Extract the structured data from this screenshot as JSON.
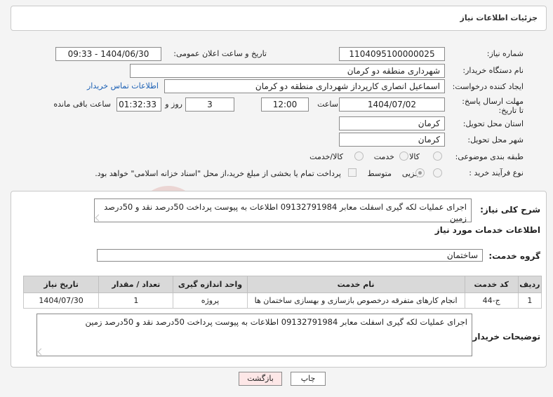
{
  "header": {
    "title": "جزئیات اطلاعات نیاز"
  },
  "fields": {
    "need_number_label": "شماره نیاز:",
    "need_number": "1104095100000025",
    "announce_label": "تاریخ و ساعت اعلان عمومی:",
    "announce_value": "1404/06/30 - 09:33",
    "buyer_org_label": "نام دستگاه خریدار:",
    "buyer_org": "شهرداری منطقه دو کرمان",
    "creator_label": "ایجاد کننده درخواست:",
    "creator": "اسماعیل انصاری کارپرداز شهرداری منطقه دو کرمان",
    "contact_link": "اطلاعات تماس خریدار",
    "deadline_label": "مهلت ارسال پاسخ: تا تاریخ:",
    "deadline_date": "1404/07/02",
    "time_label": "ساعت",
    "deadline_time": "12:00",
    "days_value": "3",
    "days_label": "روز و",
    "remaining_time": "01:32:33",
    "remaining_label": "ساعت باقی مانده",
    "province_label": "استان محل تحویل:",
    "province": "کرمان",
    "city_label": "شهر محل تحویل:",
    "city": "کرمان",
    "category_label": "طبقه بندی موضوعی:",
    "category_options": [
      "کالا",
      "خدمت",
      "کالا/خدمت"
    ],
    "process_label": "نوع فرآیند خرید :",
    "process_options": [
      "جزیی",
      "متوسط"
    ],
    "payment_note": "پرداخت تمام یا بخشی از مبلغ خرید،از محل \"اسناد خزانه اسلامی\" خواهد بود."
  },
  "summary": {
    "label": "شرح کلی نیاز:",
    "text": "اجرای عملیات لکه گیری اسفلت معابر 09132791984 اطلاعات به پیوست پرداخت 50درصد نقد و 50درصد زمین"
  },
  "services": {
    "title": "اطلاعات خدمات مورد نیاز",
    "group_label": "گروه خدمت:",
    "group_value": "ساختمان",
    "columns": [
      "ردیف",
      "کد خدمت",
      "نام خدمت",
      "واحد اندازه گیری",
      "تعداد / مقدار",
      "تاریخ نیاز"
    ],
    "rows": [
      [
        "1",
        "ج-44",
        "انجام کارهای متفرقه درخصوص بازسازی و بهسازی ساختمان ها",
        "پروژه",
        "1",
        "1404/07/30"
      ]
    ]
  },
  "buyer_notes": {
    "label": "توضیحات خریدار:",
    "text": "اجرای عملیات لکه گیری اسفلت معابر 09132791984 اطلاعات به پیوست پرداخت 50درصد نقد و 50درصد زمین"
  },
  "buttons": {
    "print": "چاپ",
    "back": "بازگشت"
  },
  "watermark": {
    "text": "AriaTender.net"
  },
  "colors": {
    "link": "#1a5fb4",
    "back_button_bg": "#fde7e7",
    "header_bg": "#d9d9d9"
  }
}
